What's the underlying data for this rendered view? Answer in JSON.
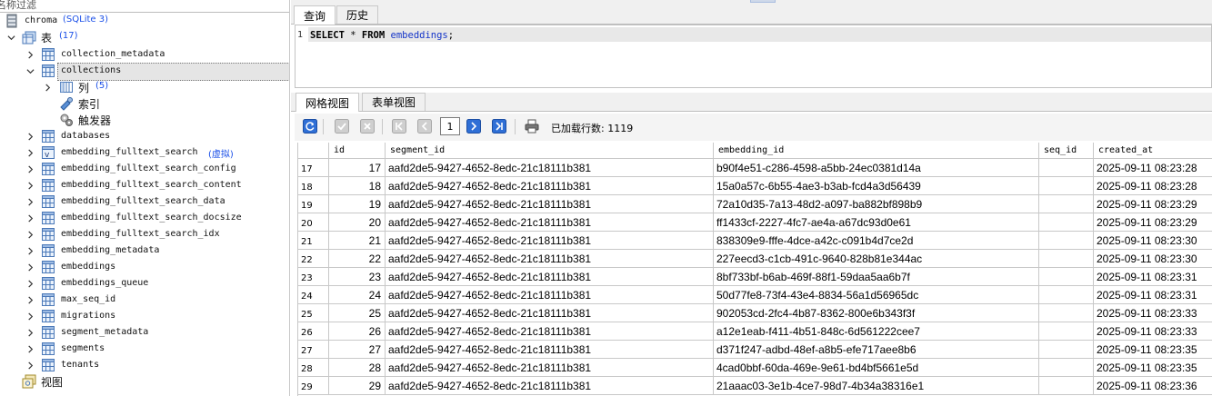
{
  "filter": {
    "placeholder": "名称过滤"
  },
  "tree": {
    "db_name": "chroma",
    "db_type": "(SQLite 3)",
    "tables_label": "表",
    "tables_count": "(17)",
    "tables": [
      "collection_metadata",
      "collections",
      "databases",
      "embedding_fulltext_search",
      "embedding_fulltext_search_config",
      "embedding_fulltext_search_content",
      "embedding_fulltext_search_data",
      "embedding_fulltext_search_docsize",
      "embedding_fulltext_search_idx",
      "embedding_metadata",
      "embeddings",
      "embeddings_queue",
      "max_seq_id",
      "migrations",
      "segment_metadata",
      "segments",
      "tenants"
    ],
    "virtual_tag": "(虚拟)",
    "collections_children": {
      "columns_label": "列",
      "columns_count": "(5)",
      "indexes_label": "索引",
      "triggers_label": "触发器"
    },
    "views_label": "视图"
  },
  "editor_tabs": [
    "查询",
    "历史"
  ],
  "editor": {
    "line_number": "1",
    "kw1": "SELECT",
    "star": " * ",
    "kw2": "FROM",
    "table": "embeddings",
    "semicolon": ";"
  },
  "view_tabs": [
    "网格视图",
    "表单视图"
  ],
  "toolbar": {
    "page_value": "1",
    "rows_loaded_label": "已加载行数: 1119"
  },
  "grid": {
    "columns": [
      "id",
      "segment_id",
      "embedding_id",
      "seq_id",
      "created_at"
    ],
    "rows": [
      [
        "17",
        "17",
        "aafd2de5-9427-4652-8edc-21c18111b381",
        "b90f4e51-c286-4598-a5bb-24ec0381d14a",
        "",
        "2025-09-11 08:23:28"
      ],
      [
        "18",
        "18",
        "aafd2de5-9427-4652-8edc-21c18111b381",
        "15a0a57c-6b55-4ae3-b3ab-fcd4a3d56439",
        "",
        "2025-09-11 08:23:28"
      ],
      [
        "19",
        "19",
        "aafd2de5-9427-4652-8edc-21c18111b381",
        "72a10d35-7a13-48d2-a097-ba882bf898b9",
        "",
        "2025-09-11 08:23:29"
      ],
      [
        "20",
        "20",
        "aafd2de5-9427-4652-8edc-21c18111b381",
        "ff1433cf-2227-4fc7-ae4a-a67dc93d0e61",
        "",
        "2025-09-11 08:23:29"
      ],
      [
        "21",
        "21",
        "aafd2de5-9427-4652-8edc-21c18111b381",
        "838309e9-fffe-4dce-a42c-c091b4d7ce2d",
        "",
        "2025-09-11 08:23:30"
      ],
      [
        "22",
        "22",
        "aafd2de5-9427-4652-8edc-21c18111b381",
        "227eecd3-c1cb-491c-9640-828b81e344ac",
        "",
        "2025-09-11 08:23:30"
      ],
      [
        "23",
        "23",
        "aafd2de5-9427-4652-8edc-21c18111b381",
        "8bf733bf-b6ab-469f-88f1-59daa5aa6b7f",
        "",
        "2025-09-11 08:23:31"
      ],
      [
        "24",
        "24",
        "aafd2de5-9427-4652-8edc-21c18111b381",
        "50d77fe8-73f4-43e4-8834-56a1d56965dc",
        "",
        "2025-09-11 08:23:31"
      ],
      [
        "25",
        "25",
        "aafd2de5-9427-4652-8edc-21c18111b381",
        "902053cd-2fc4-4b87-8362-800e6b343f3f",
        "",
        "2025-09-11 08:23:33"
      ],
      [
        "26",
        "26",
        "aafd2de5-9427-4652-8edc-21c18111b381",
        "a12e1eab-f411-4b51-848c-6d561222cee7",
        "",
        "2025-09-11 08:23:33"
      ],
      [
        "27",
        "27",
        "aafd2de5-9427-4652-8edc-21c18111b381",
        "d371f247-adbd-48ef-a8b5-efe717aee8b6",
        "",
        "2025-09-11 08:23:35"
      ],
      [
        "28",
        "28",
        "aafd2de5-9427-4652-8edc-21c18111b381",
        "4cad0bbf-60da-469e-9e61-bd4bf5661e5d",
        "",
        "2025-09-11 08:23:35"
      ],
      [
        "29",
        "29",
        "aafd2de5-9427-4652-8edc-21c18111b381",
        "21aaac03-3e1b-4ce7-98d7-4b34a38316e1",
        "",
        "2025-09-11 08:23:36"
      ]
    ]
  },
  "colors": {
    "link_blue": "#1a4fe8",
    "keyword_id": "#1434c8",
    "grid_line": "#c8c8c8"
  }
}
